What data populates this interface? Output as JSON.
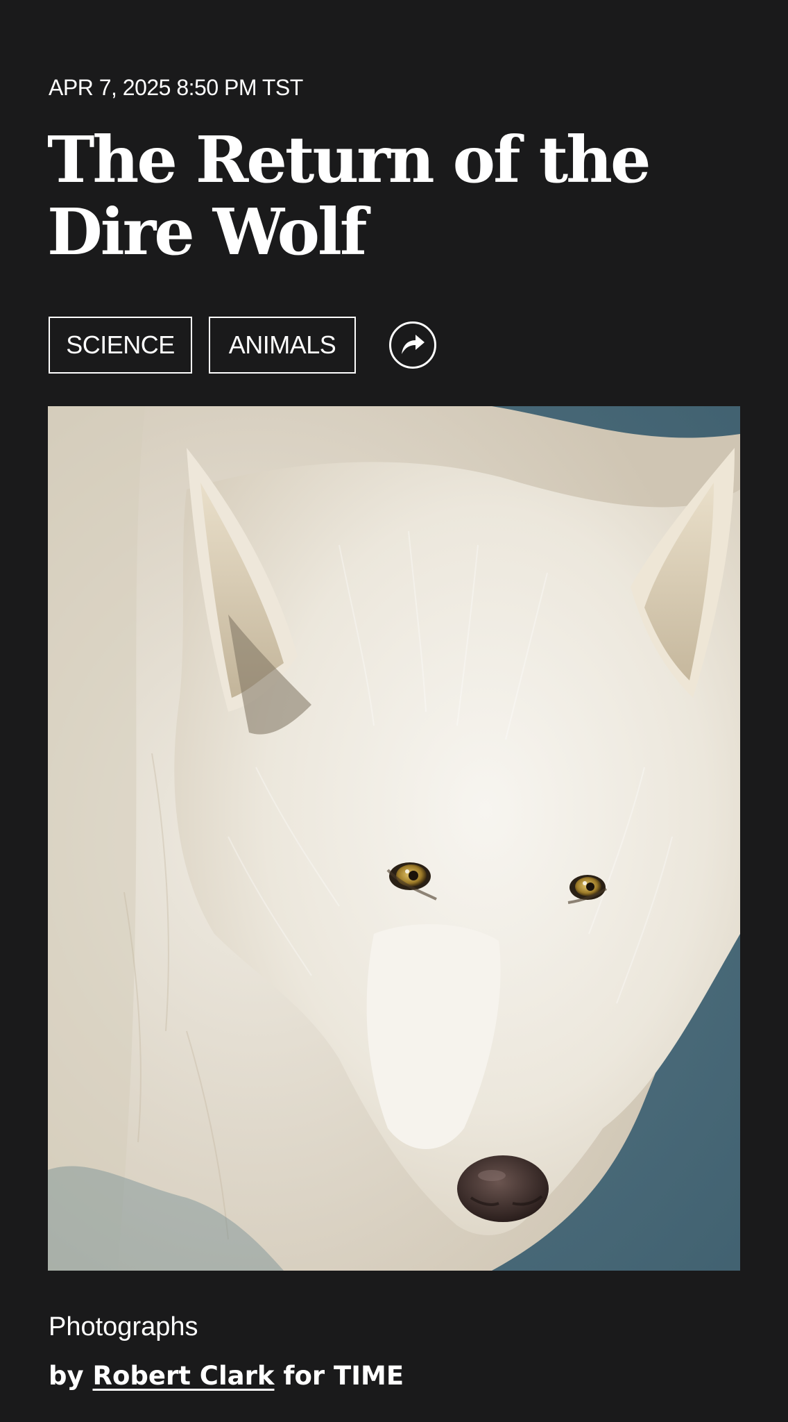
{
  "article": {
    "dateline": "APR 7, 2025 8:50 PM TST",
    "headline": "The Return of the Dire Wolf",
    "tags": [
      {
        "label": "SCIENCE"
      },
      {
        "label": "ANIMALS"
      }
    ],
    "share_icon": "share-arrow-icon"
  },
  "hero_image": {
    "subject": "white wolf portrait on blue-gray backdrop"
  },
  "credit": {
    "type": "Photographs",
    "by_prefix": "by",
    "photographer": "Robert Clark",
    "for_suffix": "for TIME"
  },
  "colors": {
    "background": "#1a1a1b",
    "text": "#ffffff",
    "backdrop": "#4a6a7a"
  }
}
